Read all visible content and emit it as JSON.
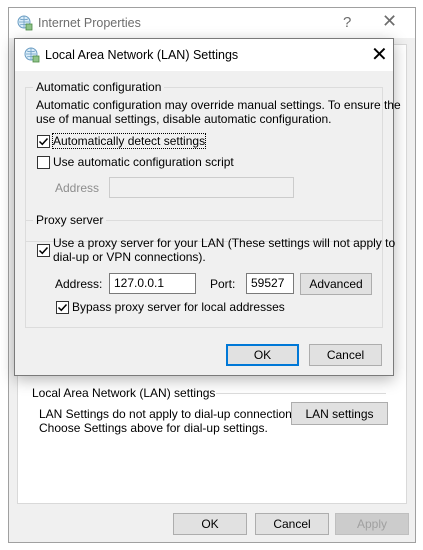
{
  "parent_window": {
    "title": "Internet Properties",
    "help_glyph": "?",
    "close_glyph": "✕",
    "lan_section": {
      "legend": "Local Area Network (LAN) settings",
      "description_line1": "LAN Settings do not apply to dial-up connections.",
      "description_line2": "Choose Settings above for dial-up settings.",
      "lan_settings_button": "LAN settings"
    },
    "footer": {
      "ok": "OK",
      "cancel": "Cancel",
      "apply": "Apply"
    }
  },
  "dialog": {
    "title": "Local Area Network (LAN) Settings",
    "close_glyph": "✕",
    "automatic_configuration": {
      "legend": "Automatic configuration",
      "description_line1": "Automatic configuration may override manual settings.  To ensure the",
      "description_line2": "use of manual settings, disable automatic configuration.",
      "auto_detect_label": "Automatically detect settings",
      "auto_detect_checked": true,
      "auto_script_label": "Use automatic configuration script",
      "auto_script_checked": false,
      "address_label": "Address",
      "address_value": ""
    },
    "proxy_server": {
      "legend": "Proxy server",
      "use_proxy_label_line1": "Use a proxy server for your LAN (These settings will not apply to",
      "use_proxy_label_line2": "dial-up or VPN connections).",
      "use_proxy_checked": true,
      "address_label": "Address:",
      "address_value": "127.0.0.1",
      "port_label": "Port:",
      "port_value": "59527",
      "advanced_button": "Advanced",
      "bypass_label": "Bypass proxy server for local addresses",
      "bypass_checked": true
    },
    "ok_button": "OK",
    "cancel_button": "Cancel"
  },
  "colors": {
    "window_bg": "#f0f0f0",
    "focus_accent": "#0078d7",
    "disabled_text": "#8d8d8d"
  },
  "icons": {
    "window_icon": "internet-options-globe-icon",
    "check": "check-mark-icon"
  }
}
